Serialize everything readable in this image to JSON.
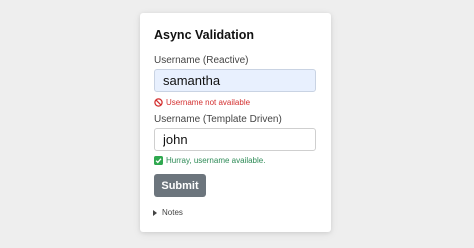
{
  "form": {
    "title": "Async Validation",
    "reactive": {
      "label": "Username (Reactive)",
      "value": "samantha",
      "message": "Username not available",
      "message_status": "error",
      "message_icon": "prohibited-icon",
      "background": "#e8f0fe"
    },
    "template": {
      "label": "Username (Template Driven)",
      "value": "john",
      "message": "Hurray, username available.",
      "message_status": "success",
      "message_icon": "check-mark-icon"
    },
    "submit_label": "Submit",
    "notes_label": "Notes"
  },
  "colors": {
    "error": "#d32f2f",
    "success": "#2e8b57",
    "button": "#6c757d"
  }
}
